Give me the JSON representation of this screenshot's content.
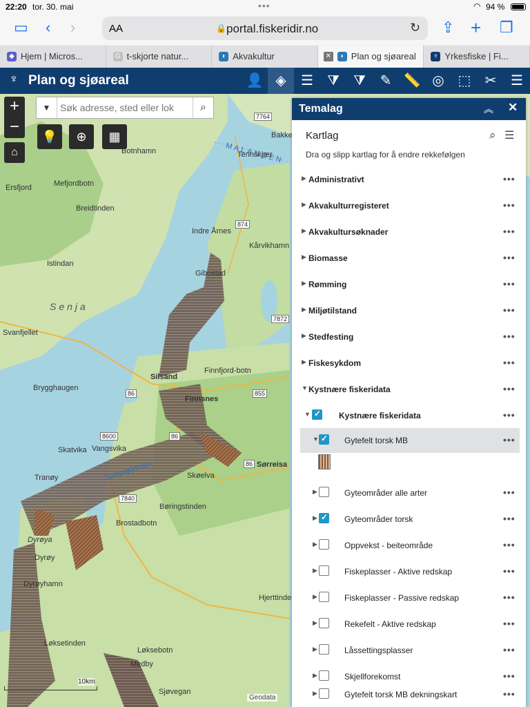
{
  "status_bar": {
    "time": "22:20",
    "date": "tor. 30. mai",
    "battery": "94 %"
  },
  "browser": {
    "aa_label": "AA",
    "url": "portal.fiskeridir.no",
    "tabs": [
      {
        "label": "Hjem | Micros...",
        "active": false,
        "fav_color": "#5b5fc7"
      },
      {
        "label": "t-skjorte natur...",
        "active": false,
        "fav_color": "#c0c0c0"
      },
      {
        "label": "Akvakultur",
        "active": false,
        "fav_color": "#2a7ab8"
      },
      {
        "label": "Plan og sjøareal",
        "active": true,
        "fav_color": "#2a7ab8"
      },
      {
        "label": "Yrkesfiske | Fi...",
        "active": false,
        "fav_color": "#0f3d6e"
      }
    ]
  },
  "app": {
    "title": "Plan og sjøareal"
  },
  "map": {
    "search_placeholder": "Søk adresse, sted eller lok",
    "scale_label": "10km",
    "attribution": "Geodata",
    "labels": [
      {
        "text": "Senja",
        "kind": "big"
      },
      {
        "text": "MALANGEN",
        "kind": "sea"
      },
      {
        "text": "Svanfjellet"
      },
      {
        "text": "Istindan"
      },
      {
        "text": "Breidtinden"
      },
      {
        "text": "Mefjordbotn"
      },
      {
        "text": "Ersfjord"
      },
      {
        "text": "Botnhamn"
      },
      {
        "text": "Indre Årnes"
      },
      {
        "text": "Kårvikhamn"
      },
      {
        "text": "Gibostad"
      },
      {
        "text": "Silsand"
      },
      {
        "text": "Finnsnes"
      },
      {
        "text": "Finnfjord-botn"
      },
      {
        "text": "Brygghaugen"
      },
      {
        "text": "Skatvika"
      },
      {
        "text": "Vangsvika"
      },
      {
        "text": "Tranøy"
      },
      {
        "text": "Skøelva"
      },
      {
        "text": "Sørreisa"
      },
      {
        "text": "Brostadbotn"
      },
      {
        "text": "Børingstinden"
      },
      {
        "text": "Dyrøya"
      },
      {
        "text": "Dyrøy"
      },
      {
        "text": "Dyrøyhamn"
      },
      {
        "text": "Løksetinden"
      },
      {
        "text": "Løksebotn"
      },
      {
        "text": "Sjøvegan"
      },
      {
        "text": "Medby"
      },
      {
        "text": "Hjerttinden"
      },
      {
        "text": "Tennskjær"
      },
      {
        "text": "Bakkeby"
      },
      {
        "text": "Solbergfjorden"
      }
    ],
    "road_numbers": [
      "7764",
      "874",
      "7872",
      "855",
      "86",
      "8600",
      "7840",
      "86",
      "86"
    ]
  },
  "panel": {
    "title": "Temalag",
    "heading": "Kartlag",
    "subtitle": "Dra og slipp kartlag for å endre rekkefølgen",
    "more_label": "•••",
    "groups": [
      "Administrativt",
      "Akvakulturregisteret",
      "Akvakultursøknader",
      "Biomasse",
      "Rømming",
      "Miljøtilstand",
      "Stedfesting",
      "Fiskesykdom",
      "Kystnære fiskeridata"
    ],
    "subgroup": {
      "label": "Kystnære fiskeridata",
      "checked": true
    },
    "layers": [
      {
        "label": "Gytefelt torsk MB",
        "checked": true,
        "highlighted": true
      },
      {
        "label": "Gyteområder alle arter",
        "checked": false
      },
      {
        "label": "Gyteområder torsk",
        "checked": true
      },
      {
        "label": "Oppvekst - beiteområde",
        "checked": false
      },
      {
        "label": "Fiskeplasser - Aktive redskap",
        "checked": false
      },
      {
        "label": "Fiskeplasser - Passive redskap",
        "checked": false
      },
      {
        "label": "Rekefelt - Aktive redskap",
        "checked": false
      },
      {
        "label": "Låssettingsplasser",
        "checked": false
      },
      {
        "label": "Skjellforekomst",
        "checked": false
      },
      {
        "label": "Gytefelt torsk MB dekningskart",
        "checked": false
      }
    ]
  }
}
